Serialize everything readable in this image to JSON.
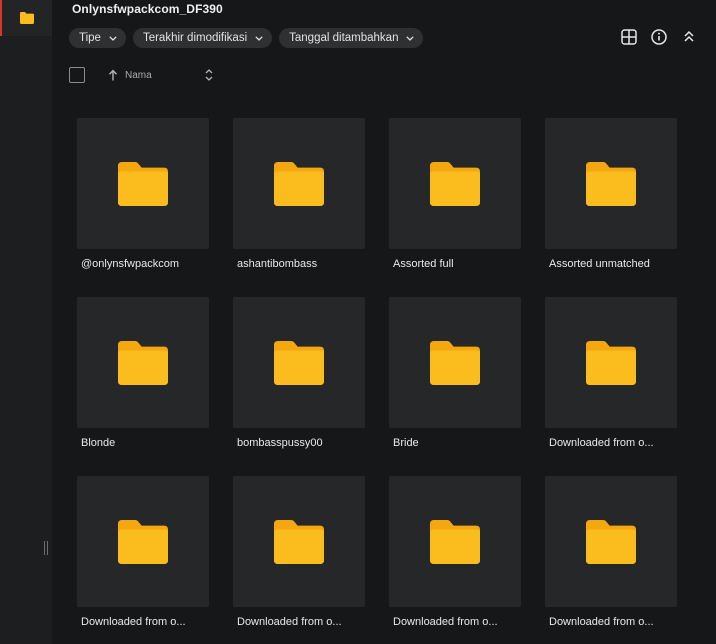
{
  "window": {
    "title": "Onlynsfwpackcom_DF390"
  },
  "filters": [
    {
      "label": "Tipe"
    },
    {
      "label": "Terakhir dimodifikasi"
    },
    {
      "label": "Tanggal ditambahkan"
    }
  ],
  "sort": {
    "label": "Nama",
    "direction": "ascending"
  },
  "colors": {
    "folder": "#fbbd1d",
    "folder_tab": "#f5a70f",
    "accent": "#d9362b"
  },
  "folders": [
    {
      "name": "@onlynsfwpackcom"
    },
    {
      "name": "ashantibombass"
    },
    {
      "name": "Assorted full"
    },
    {
      "name": "Assorted unmatched"
    },
    {
      "name": "Blonde"
    },
    {
      "name": "bombasspussy00"
    },
    {
      "name": "Bride"
    },
    {
      "name": "Downloaded from o..."
    },
    {
      "name": "Downloaded from o..."
    },
    {
      "name": "Downloaded from o..."
    },
    {
      "name": "Downloaded from o..."
    },
    {
      "name": "Downloaded from o..."
    }
  ]
}
